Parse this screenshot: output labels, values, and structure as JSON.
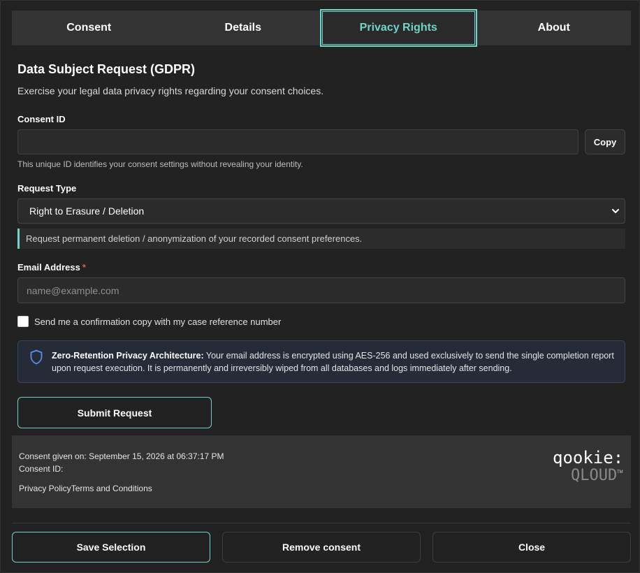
{
  "tabs": [
    {
      "label": "Consent",
      "active": false
    },
    {
      "label": "Details",
      "active": false
    },
    {
      "label": "Privacy Rights",
      "active": true
    },
    {
      "label": "About",
      "active": false
    }
  ],
  "form": {
    "title": "Data Subject Request (GDPR)",
    "subtitle": "Exercise your legal data privacy rights regarding your consent choices.",
    "consent_id_label": "Consent ID",
    "consent_id_value": "",
    "copy_label": "Copy",
    "consent_id_hint": "This unique ID identifies your consent settings without revealing your identity.",
    "request_type_label": "Request Type",
    "request_type_selected": "Right to Erasure / Deletion",
    "request_type_description": "Request permanent deletion / anonymization of your recorded consent preferences.",
    "email_label": "Email Address",
    "email_required_mark": "*",
    "email_value": "",
    "email_placeholder": "name@example.com",
    "confirmation_checkbox_label": "Send me a confirmation copy with my case reference number",
    "confirmation_checked": false,
    "notice_title": "Zero-Retention Privacy Architecture:",
    "notice_body": "Your email address is encrypted using AES-256 and used exclusively to send the single completion report upon request execution. It is permanently and irreversibly wiped from all databases and logs immediately after sending.",
    "submit_label": "Submit Request"
  },
  "footer": {
    "consent_given": "Consent given on: September 15, 2026 at 06:37:17 PM",
    "consent_id_label": "Consent ID:",
    "consent_id_value": "",
    "privacy_policy": "Privacy Policy",
    "terms": "Terms and Conditions",
    "logo_top": "qookie:",
    "logo_bottom": "QLOUD",
    "logo_tm": "TM"
  },
  "buttons": {
    "save": "Save Selection",
    "remove": "Remove consent",
    "close": "Close"
  },
  "colors": {
    "accent": "#6fd3c6",
    "background": "#222222",
    "panel": "#333333",
    "notice_bg": "#262b38",
    "required": "#e0564f"
  },
  "icons": {
    "notice": "shield-icon",
    "select": "chevron-down-icon"
  }
}
